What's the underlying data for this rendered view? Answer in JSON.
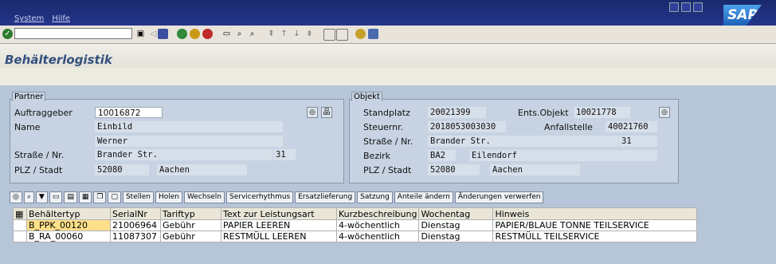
{
  "menu": {
    "system": "System",
    "help": "Hilfe"
  },
  "app_title": "Behälterlogistik",
  "brand": "SAP",
  "partner": {
    "group_label": "Partner",
    "auftraggeber_label": "Auftraggeber",
    "auftraggeber_value": "10016872",
    "name_label": "Name",
    "name_line1": "Einbild",
    "name_line2": "Werner",
    "strasse_label": "Straße / Nr.",
    "strasse_value": "Brander Str.",
    "hausnr_value": "31",
    "plz_label": "PLZ / Stadt",
    "plz_value": "52080",
    "stadt_value": "Aachen"
  },
  "objekt": {
    "group_label": "Objekt",
    "standplatz_label": "Standplatz",
    "standplatz_value": "20021399",
    "ents_label": "Ents.Objekt",
    "ents_value": "10021778",
    "steuernr_label": "Steuernr.",
    "steuernr_value": "2018053003030",
    "anfall_label": "Anfallstelle",
    "anfall_value": "40021760",
    "strasse_label": "Straße / Nr.",
    "strasse_value": "Brander Str.",
    "hausnr_value": "31",
    "bezirk_label": "Bezirk",
    "bezirk_code": "BA2",
    "bezirk_name": "Eilendorf",
    "plz_label": "PLZ / Stadt",
    "plz_value": "52080",
    "stadt_value": "Aachen"
  },
  "table_toolbar": {
    "stellen": "Stellen",
    "holen": "Holen",
    "wechseln": "Wechseln",
    "servicerhythmus": "Servicerhythmus",
    "ersatzlieferung": "Ersatzlieferung",
    "satzung": "Satzung",
    "anteile": "Anteile ändern",
    "aenderungen": "Änderungen verwerfen"
  },
  "table": {
    "headers": [
      "Behältertyp",
      "SerialNr",
      "Tariftyp",
      "Text zur Leistungsart",
      "Kurzbeschreibung",
      "Wochentag",
      "Hinweis"
    ],
    "rows": [
      [
        "B_PPK_00120",
        "21006964",
        "Gebühr",
        "PAPIER LEEREN",
        "4-wöchentlich",
        "Dienstag",
        "PAPIER/BLAUE TONNE TEILSERVICE"
      ],
      [
        "B_RA_00060",
        "11087307",
        "Gebühr",
        "RESTMÜLL LEEREN",
        "4-wöchentlich",
        "Dienstag",
        "RESTMÜLL TEILSERVICE"
      ]
    ]
  }
}
